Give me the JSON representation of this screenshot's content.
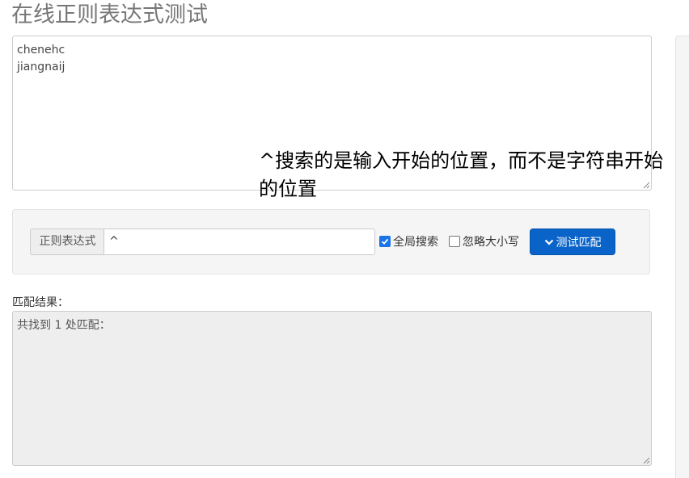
{
  "page": {
    "title": "在线正则表达式测试"
  },
  "source": {
    "text": "chenehc\njiangnaij"
  },
  "annotation": {
    "text": "^搜索的是输入开始的位置，而不是字符串开始的位置"
  },
  "regex": {
    "addon_label": "正则表达式",
    "value": "^"
  },
  "options": {
    "global_label": "全局搜索",
    "global_checked": true,
    "ignore_case_label": "忽略大小写",
    "ignore_case_checked": false
  },
  "button": {
    "match_label": "测试匹配",
    "icon": "chevron-down-icon"
  },
  "result": {
    "label": "匹配结果：",
    "text": "共找到 1 处匹配："
  },
  "colors": {
    "primary": "#0a63c9",
    "checkbox_accent": "#1a73e8",
    "title": "#777777",
    "well": "#f5f5f5",
    "readonly": "#eeeeee"
  }
}
